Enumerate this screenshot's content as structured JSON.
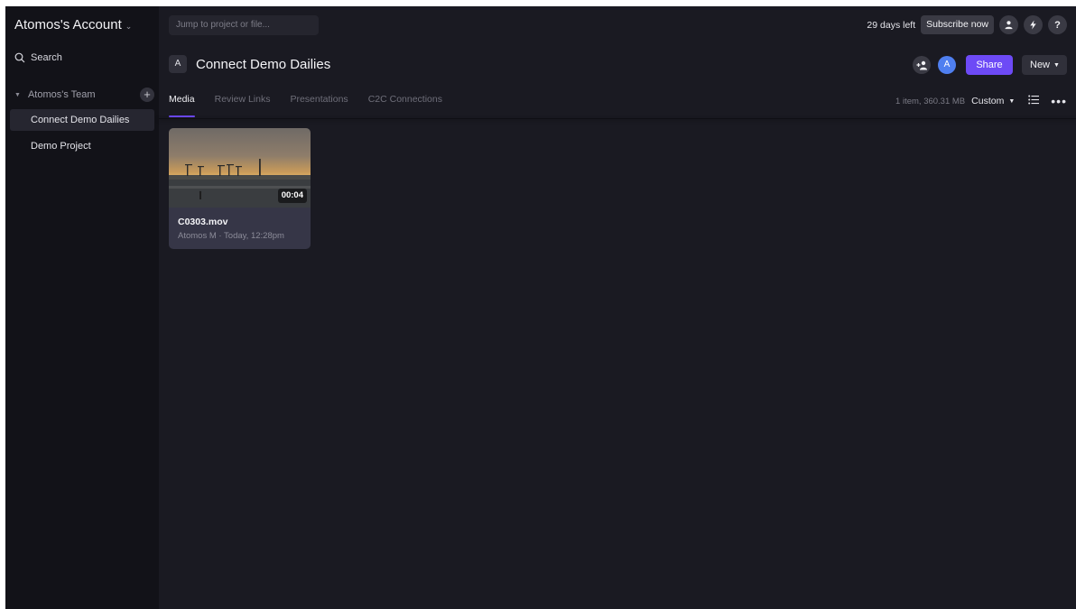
{
  "sidebar": {
    "account_name": "Atomos's Account",
    "search_label": "Search",
    "team_name": "Atomos's Team",
    "projects": [
      {
        "label": "Connect Demo Dailies",
        "active": true
      },
      {
        "label": "Demo Project",
        "active": false
      }
    ]
  },
  "topbar": {
    "jump_placeholder": "Jump to project or file...",
    "trial_text": "29 days left",
    "subscribe_label": "Subscribe now",
    "help_label": "?"
  },
  "project": {
    "initial": "A",
    "title": "Connect Demo Dailies",
    "avatar_initial": "A",
    "share_label": "Share",
    "new_label": "New"
  },
  "tabs": [
    "Media",
    "Review Links",
    "Presentations",
    "C2C Connections"
  ],
  "toolbar": {
    "summary": "1 item, 360.31 MB",
    "sort_label": "Custom"
  },
  "assets": [
    {
      "duration": "00:04",
      "name": "C0303.mov",
      "meta": "Atomos M · Today, 12:28pm"
    }
  ],
  "colors": {
    "accent": "#6d4af6",
    "avatar": "#4f7ff0",
    "background": "#1a1a22",
    "sidebar": "#121218"
  },
  "icons": {
    "search": "search-icon",
    "user": "user-icon",
    "bolt": "lightning-icon",
    "add_user": "add-user-icon",
    "list_view": "list-view-icon",
    "more": "more-icon"
  }
}
